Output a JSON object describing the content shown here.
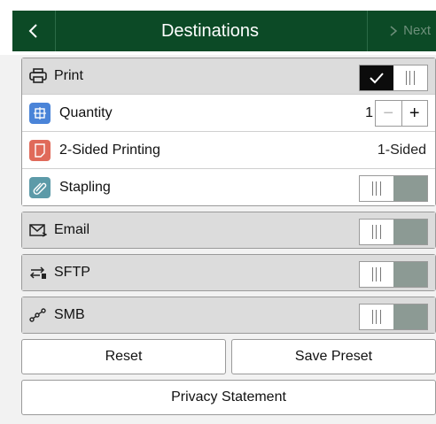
{
  "header": {
    "title": "Destinations",
    "next_label": "Next",
    "back_icon": "chevron-left-icon",
    "next_icon": "chevron-right-icon"
  },
  "print": {
    "label": "Print",
    "icon": "printer-icon",
    "enabled": true,
    "quantity": {
      "label": "Quantity",
      "value": "1",
      "minus": "−",
      "plus": "+",
      "icon_color": "#4a84d8"
    },
    "duplex": {
      "label": "2-Sided Printing",
      "value": "1-Sided",
      "icon_color": "#e06a5a"
    },
    "stapling": {
      "label": "Stapling",
      "enabled": false,
      "icon_color": "#5c9aa8"
    }
  },
  "email": {
    "label": "Email",
    "icon": "envelope-icon",
    "enabled": false
  },
  "sftp": {
    "label": "SFTP",
    "icon": "transfer-icon",
    "enabled": false
  },
  "smb": {
    "label": "SMB",
    "icon": "network-icon",
    "enabled": false
  },
  "buttons": {
    "reset": "Reset",
    "save_preset": "Save Preset",
    "privacy": "Privacy Statement"
  },
  "colors": {
    "header_bg": "#0c4a26",
    "toggle_on": "#0c0c0c",
    "toggle_off": "#8c9a94"
  }
}
